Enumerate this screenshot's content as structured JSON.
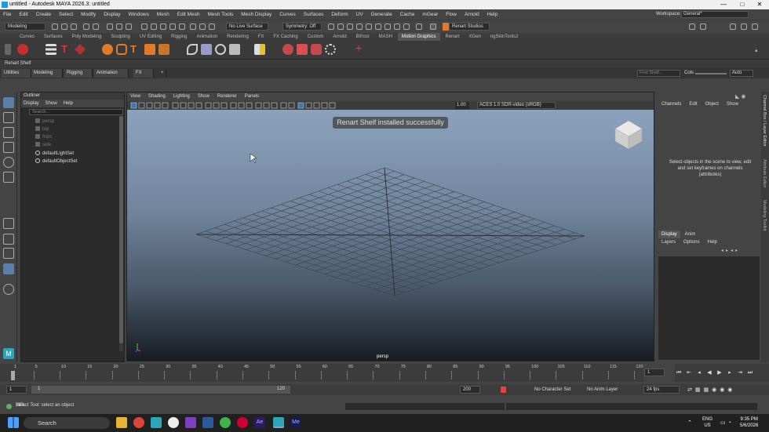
{
  "window": {
    "title": "untitled - Autodesk MAYA 2026.3: untitled",
    "minimize": "—",
    "maximize": "□",
    "close": "✕",
    "workspace_label": "Workspace:",
    "workspace_value": "General*"
  },
  "menubar": [
    "File",
    "Edit",
    "Create",
    "Select",
    "Modify",
    "Display",
    "Windows",
    "Mesh",
    "Edit Mesh",
    "Mesh Tools",
    "Mesh Display",
    "Curves",
    "Surfaces",
    "Deform",
    "UV",
    "Generate",
    "Cache",
    "mGear",
    "Flow",
    "Arnold",
    "Help"
  ],
  "statusline": {
    "mode": "Modeling",
    "live_surface": "No Live Surface",
    "symmetry": "Symmetry: Off",
    "renart": "Renart Studios"
  },
  "shelf_tabs": [
    "Curves",
    "Surfaces",
    "Poly Modeling",
    "Sculpting",
    "UV Editing",
    "Rigging",
    "Animation",
    "Rendering",
    "FX",
    "FX Caching",
    "Custom",
    "Arnold",
    "Bifrost",
    "MASH",
    "Motion Graphics",
    "Renart",
    "XGen",
    "ngSkinTools2"
  ],
  "shelf_active_tab": "Motion Graphics",
  "renart_shelf_label": "Renart Shelf",
  "workspace_tabs": [
    "Utilities",
    "Modeling",
    "Rigging",
    "Animation",
    "FX"
  ],
  "workspace_add": "+",
  "find_shelf_placeholder": "Find Shelf...",
  "cols_label": "Cols",
  "cols_value": "Auto",
  "outliner": {
    "title": "Outliner",
    "menus": [
      "Display",
      "Show",
      "Help"
    ],
    "search_placeholder": "Search...",
    "items": [
      "persp",
      "top",
      "front",
      "side",
      "defaultLightSet",
      "defaultObjectSet"
    ]
  },
  "viewport": {
    "menus": [
      "View",
      "Shading",
      "Lighting",
      "Show",
      "Renderer",
      "Panels"
    ],
    "toast": "Renart Shelf installed successfully",
    "exposure": "1.00",
    "color_space": "ACES 1.0 SDR-video (sRGB)",
    "camera_label": "persp"
  },
  "channel_box": {
    "menus": [
      "Channels",
      "Edit",
      "Object",
      "Show"
    ],
    "message": "Select objects in the scene to view, edit and set keyframes on channels (attributes)"
  },
  "layer_editor": {
    "tabs": [
      "Display",
      "Anim"
    ],
    "menus": [
      "Layers",
      "Options",
      "Help"
    ]
  },
  "side_tabs": [
    "Channel Box / Layer Editor",
    "Attribute Editor",
    "Modeling Toolkit"
  ],
  "timeline": {
    "ticks": [
      1,
      5,
      10,
      15,
      20,
      25,
      30,
      35,
      40,
      45,
      50,
      55,
      60,
      65,
      70,
      75,
      80,
      85,
      90,
      95,
      100,
      105,
      110,
      115,
      120
    ],
    "current_frame": "1"
  },
  "range": {
    "start": "1",
    "inner_start": "1",
    "inner_end": "120",
    "end": "200",
    "character_set": "No Character Set",
    "anim_layer": "No Anim Layer",
    "fps": "24 fps"
  },
  "help_line": "Select Tool: select an object",
  "mel_label": "MEL",
  "taskbar": {
    "search": "Search",
    "lang_top": "ENG",
    "lang_bottom": "US",
    "time": "9:35 PM",
    "date": "5/6/2026"
  },
  "colors": {
    "accent_blue": "#1a9fd8",
    "renart_orange": "#e07b2a",
    "maya_teal": "#2aa6b8"
  }
}
